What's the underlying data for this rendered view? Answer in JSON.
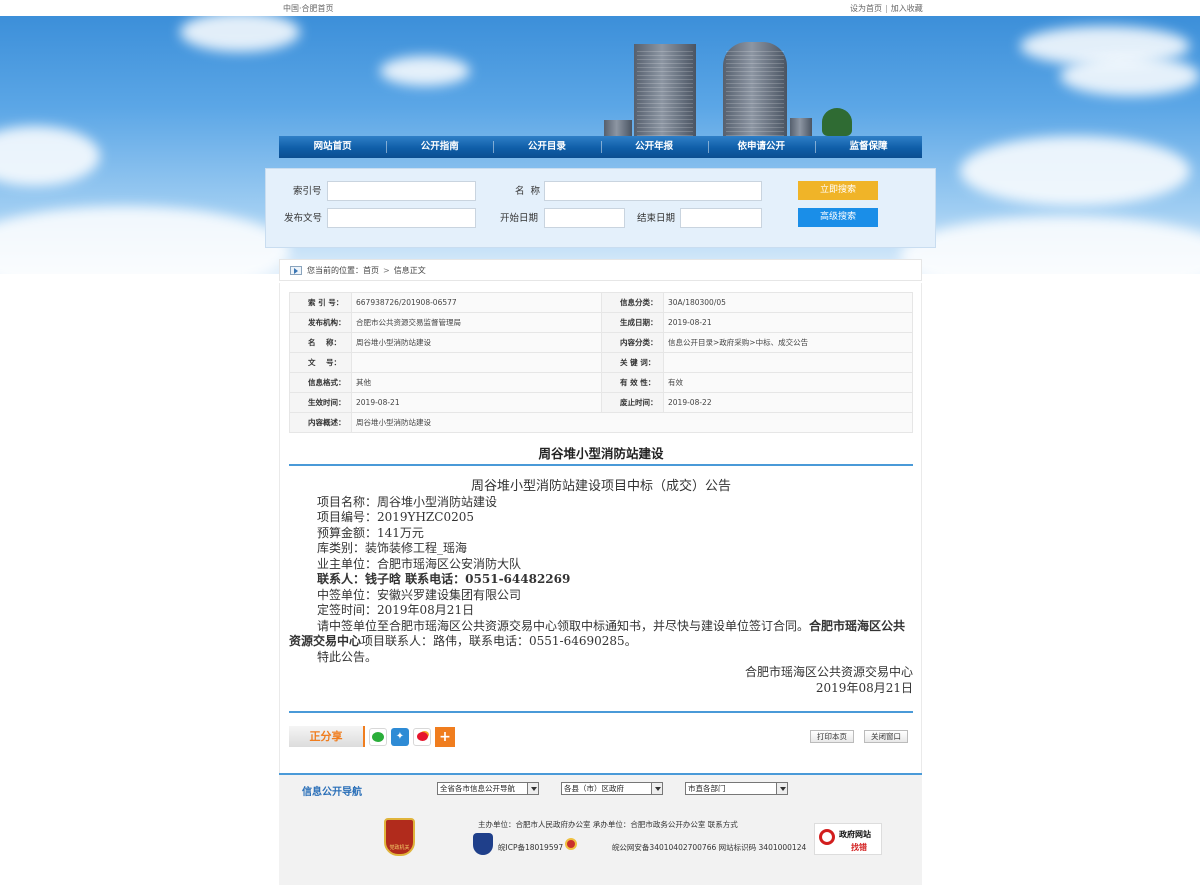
{
  "topbar": {
    "left": "中国·合肥首页",
    "set_home": "设为首页",
    "separator": "|",
    "add_fav": "加入收藏"
  },
  "nav": {
    "items": [
      "网站首页",
      "公开指南",
      "公开目录",
      "公开年报",
      "依申请公开",
      "监督保障"
    ]
  },
  "search": {
    "index_label": "索引号",
    "name_label": "名  称",
    "doc_no_label": "发布文号",
    "start_label": "开始日期",
    "end_label": "结束日期",
    "search_btn": "立即搜索",
    "advanced_btn": "高级搜索"
  },
  "breadcrumb": {
    "prefix": "您当前的位置：",
    "home": "首页",
    "sep": ">",
    "current": "信息正文"
  },
  "meta": {
    "rows": [
      {
        "k1": "索 引 号：",
        "v1": "667938726/201908-06577",
        "k2": "信息分类：",
        "v2": "30A/180300/05"
      },
      {
        "k1": "发布机构：",
        "v1": "合肥市公共资源交易监督管理局",
        "k2": "生成日期：",
        "v2": "2019-08-21"
      },
      {
        "k1": "名    称：",
        "v1": "周谷堆小型消防站建设",
        "k2": "内容分类：",
        "v2": "信息公开目录>政府采购>中标、成交公告"
      },
      {
        "k1": "文    号：",
        "v1": "",
        "k2": "关 键 词：",
        "v2": ""
      },
      {
        "k1": "信息格式：",
        "v1": "其他",
        "k2": "有 效 性：",
        "v2": "有效"
      },
      {
        "k1": "生效时间：",
        "v1": "2019-08-21",
        "k2": "废止时间：",
        "v2": "2019-08-22"
      }
    ],
    "summary_key": "内容概述：",
    "summary_val": "周谷堆小型消防站建设"
  },
  "article": {
    "title": "周谷堆小型消防站建设",
    "heading": "周谷堆小型消防站建设项目中标（成交）公告",
    "lines": [
      "项目名称：周谷堆小型消防站建设",
      "项目编号：2019YHZC0205",
      "预算金额：141万元",
      "库类别：装饰装修工程_瑶海",
      "业主单位：合肥市瑶海区公安消防大队"
    ],
    "contact_line": "联系人：钱子晗  联系电话：0551-64482269",
    "lines2": [
      "中签单位：安徽兴罗建设集团有限公司",
      "定签时间：2019年08月21日"
    ],
    "para": "请中签单位至合肥市瑶海区公共资源交易中心领取中标通知书，并尽快与建设单位签订合同。",
    "para_bold": "合肥市瑶海区公共资源交易中心",
    "para_tail": "项目联系人：路伟，联系电话：0551-64690285。",
    "closing": "特此公告。",
    "signer": "合肥市瑶海区公共资源交易中心",
    "date": "2019年08月21日"
  },
  "share": {
    "label": "正分享",
    "more": "+"
  },
  "actions": {
    "print": "打印本页",
    "close": "关闭窗口"
  },
  "footer": {
    "nav_label": "信息公开导航",
    "select1": "全省各市信息公开导航",
    "select2": "各县（市）区政府",
    "select3": "市直各部门",
    "line1": "主办单位：合肥市人民政府办公室  承办单位：合肥市政务公开办公室  联系方式",
    "icp": "皖ICP备18019597",
    "police": "皖公网安备34010402700766",
    "site_code": "网站标识码 3401000124",
    "badge_text": "党政机关",
    "gov_t1": "政府网站",
    "gov_t2": "找错"
  }
}
